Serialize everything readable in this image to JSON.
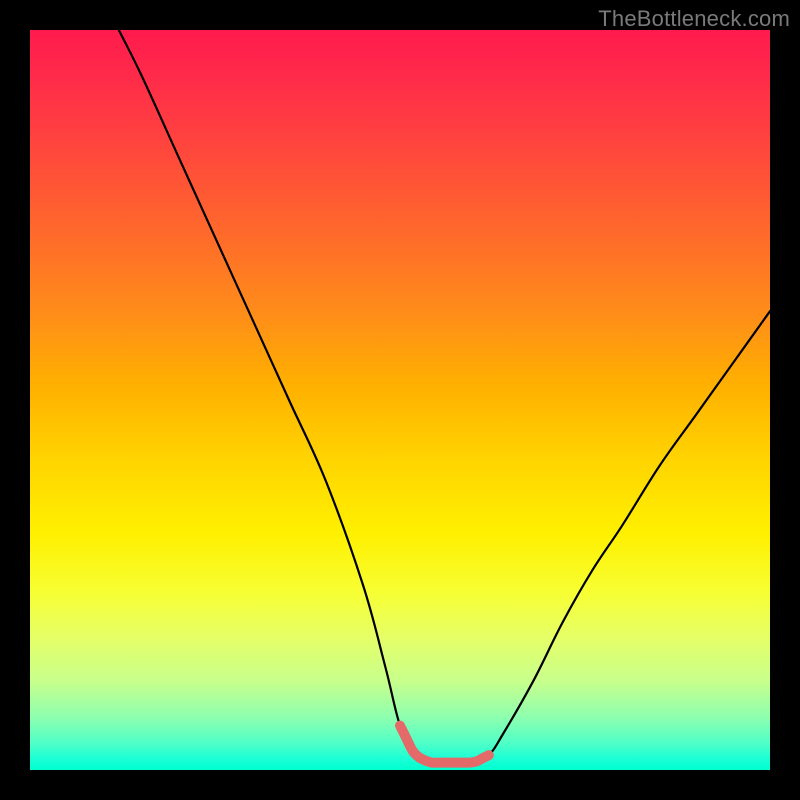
{
  "watermark": "TheBottleneck.com",
  "chart_data": {
    "type": "line",
    "title": "",
    "xlabel": "",
    "ylabel": "",
    "xlim": [
      0,
      100
    ],
    "ylim": [
      0,
      100
    ],
    "series": [
      {
        "name": "curve",
        "x": [
          12,
          15,
          20,
          25,
          30,
          35,
          40,
          45,
          48,
          50,
          52,
          54,
          56,
          58,
          60,
          62,
          64,
          68,
          72,
          76,
          80,
          85,
          90,
          95,
          100
        ],
        "values": [
          100,
          94,
          83,
          72,
          61,
          50,
          39,
          25,
          14,
          6,
          2,
          1,
          1,
          1,
          1,
          2,
          5,
          12,
          20,
          27,
          33,
          41,
          48,
          55,
          62
        ]
      }
    ],
    "flat_segment": {
      "x_start": 50,
      "x_end": 62,
      "color": "#e46a6a",
      "stroke_width": 10
    },
    "gradient_background": true
  }
}
